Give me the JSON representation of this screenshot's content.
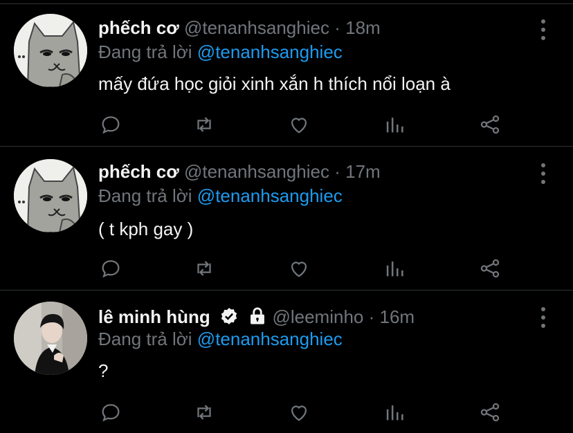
{
  "tweets": [
    {
      "name": "phếch cơ",
      "handle": "@tenanhsanghiec",
      "separator": "·",
      "time": "18m",
      "reply_prefix": "Đang trả lời",
      "reply_to": "@tenanhsanghiec",
      "text": "mấy đứa học giỏi xinh xắn h thích nổi loạn à",
      "avatar": "cat-avatar",
      "verified": false,
      "protected": false
    },
    {
      "name": "phếch cơ",
      "handle": "@tenanhsanghiec",
      "separator": "·",
      "time": "17m",
      "reply_prefix": "Đang trả lời",
      "reply_to": "@tenanhsanghiec",
      "text": "( t kph gay )",
      "avatar": "cat-avatar",
      "verified": false,
      "protected": false
    },
    {
      "name": "lê minh hùng",
      "handle": "@leeminho",
      "separator": "·",
      "time": "16m",
      "reply_prefix": "Đang trả lời",
      "reply_to": "@tenanhsanghiec",
      "text": "?",
      "avatar": "photo-avatar",
      "verified": true,
      "protected": true
    }
  ],
  "icons": {
    "reply": "comment-icon",
    "retweet": "retweet-icon",
    "like": "heart-icon",
    "views": "bar-chart-icon",
    "share": "share-icon",
    "more": "more-vertical-icon",
    "verified": "verified-badge-icon",
    "protected": "lock-icon"
  },
  "colors": {
    "background": "#000000",
    "text": "#f3f3f3",
    "muted": "#71767b",
    "mention": "#1d9bf0",
    "divider": "#2f3336"
  }
}
